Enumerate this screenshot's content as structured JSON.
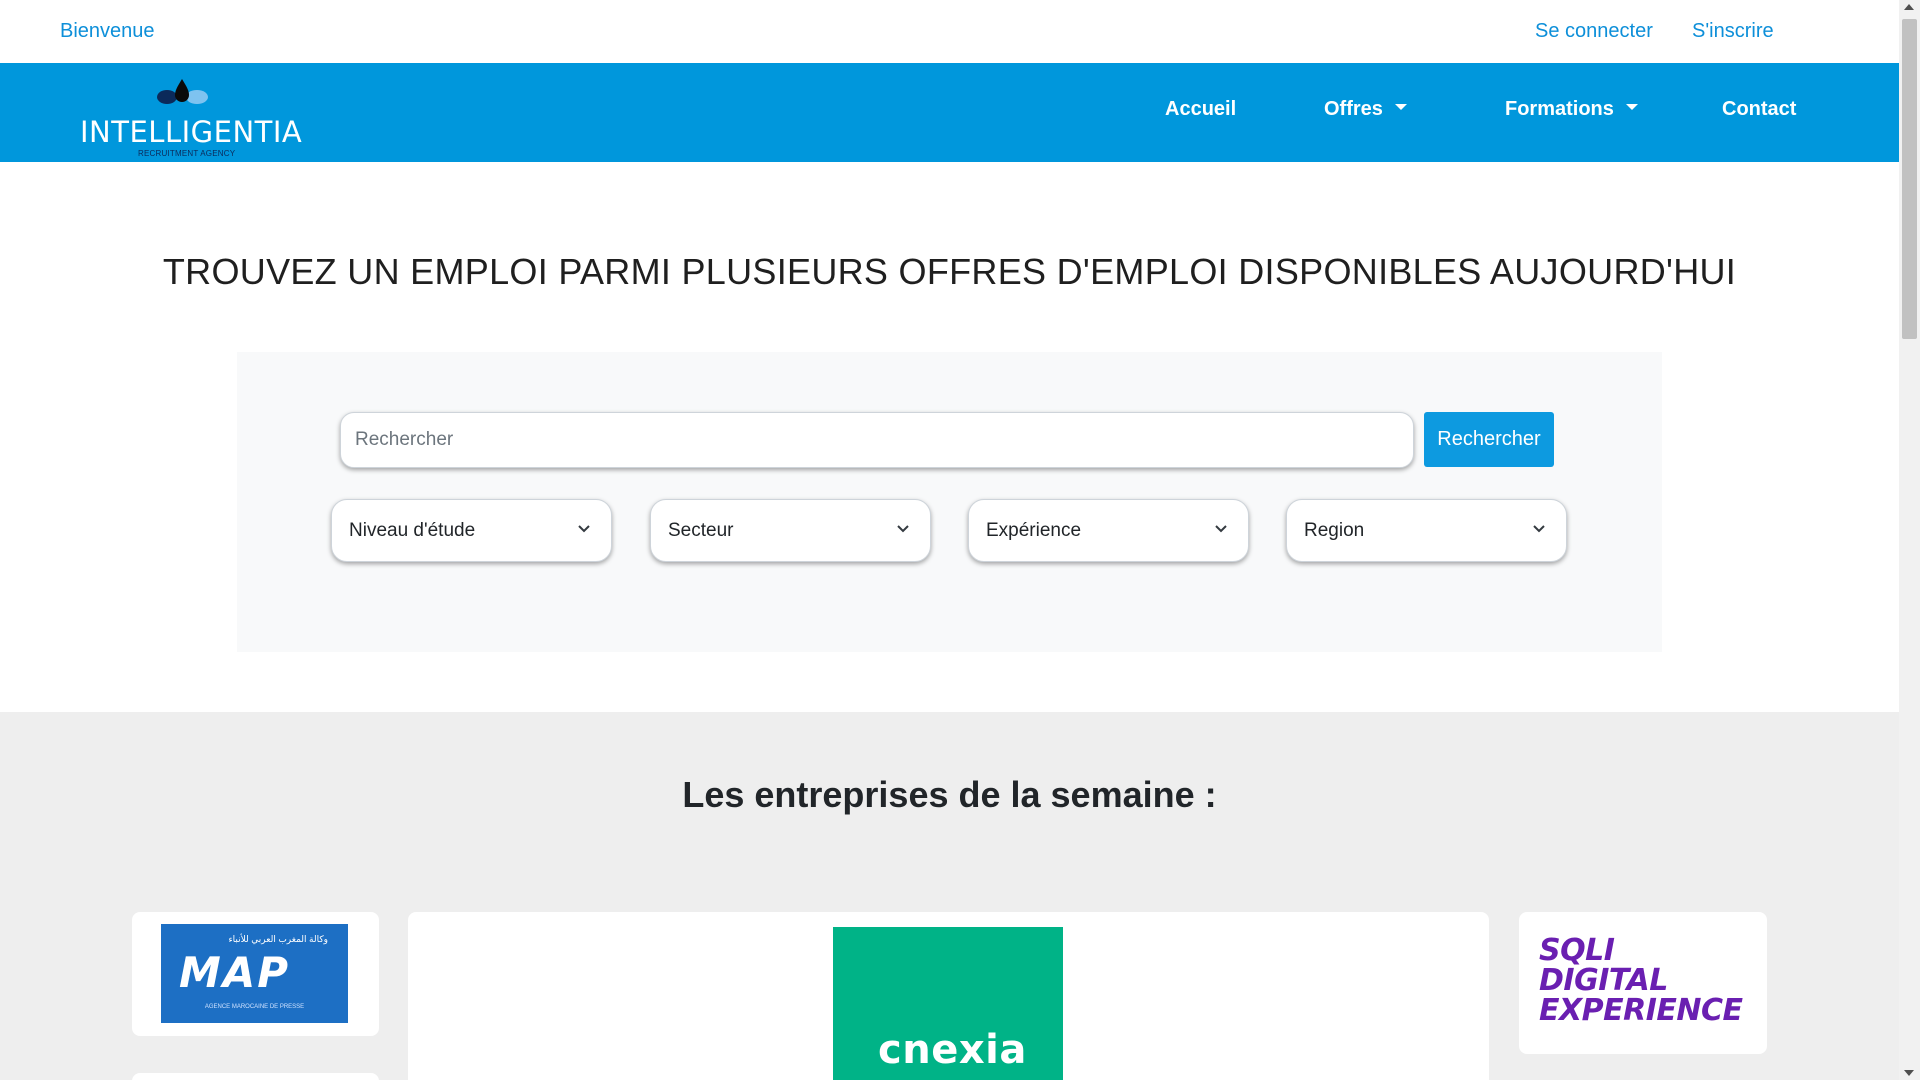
{
  "topbar": {
    "welcome": "Bienvenue",
    "login": "Se connecter",
    "signup": "S'inscrire"
  },
  "brand": {
    "name": "INTELLIGENTIA",
    "tagline": "RECRUITMENT AGENCY"
  },
  "nav": {
    "items": [
      {
        "label": "Accueil",
        "dropdown": false
      },
      {
        "label": "Offres",
        "dropdown": true
      },
      {
        "label": "Formations",
        "dropdown": true
      },
      {
        "label": "Contact",
        "dropdown": false
      }
    ]
  },
  "hero": {
    "title": "TROUVEZ UN EMPLOI PARMI PLUSIEURS OFFRES D'EMPLOI DISPONIBLES AUJOURD'HUI"
  },
  "search": {
    "placeholder": "Rechercher",
    "button_label": "Rechercher",
    "filters": [
      {
        "label": "Niveau d'étude"
      },
      {
        "label": "Secteur"
      },
      {
        "label": "Expérience"
      },
      {
        "label": "Region"
      }
    ]
  },
  "companies": {
    "title": "Les entreprises de la semaine :",
    "logos": [
      {
        "name": "MAP",
        "arabic": "وكالة المغرب العربي للأنباء",
        "subtitle": "AGENCE MAROCAINE DE PRESSE",
        "color": "#1d6fc4"
      },
      {
        "name": "cnexia",
        "color": "#00b387"
      },
      {
        "name": "SQLI DIGITAL EXPERIENCE",
        "lines": [
          "SQLI",
          "DIGITAL",
          "EXPERIENCE"
        ],
        "color": "#6a1fb1"
      }
    ]
  },
  "colors": {
    "primary": "#0097dc",
    "link": "#0d8fd9",
    "button": "#0d9ae0"
  }
}
